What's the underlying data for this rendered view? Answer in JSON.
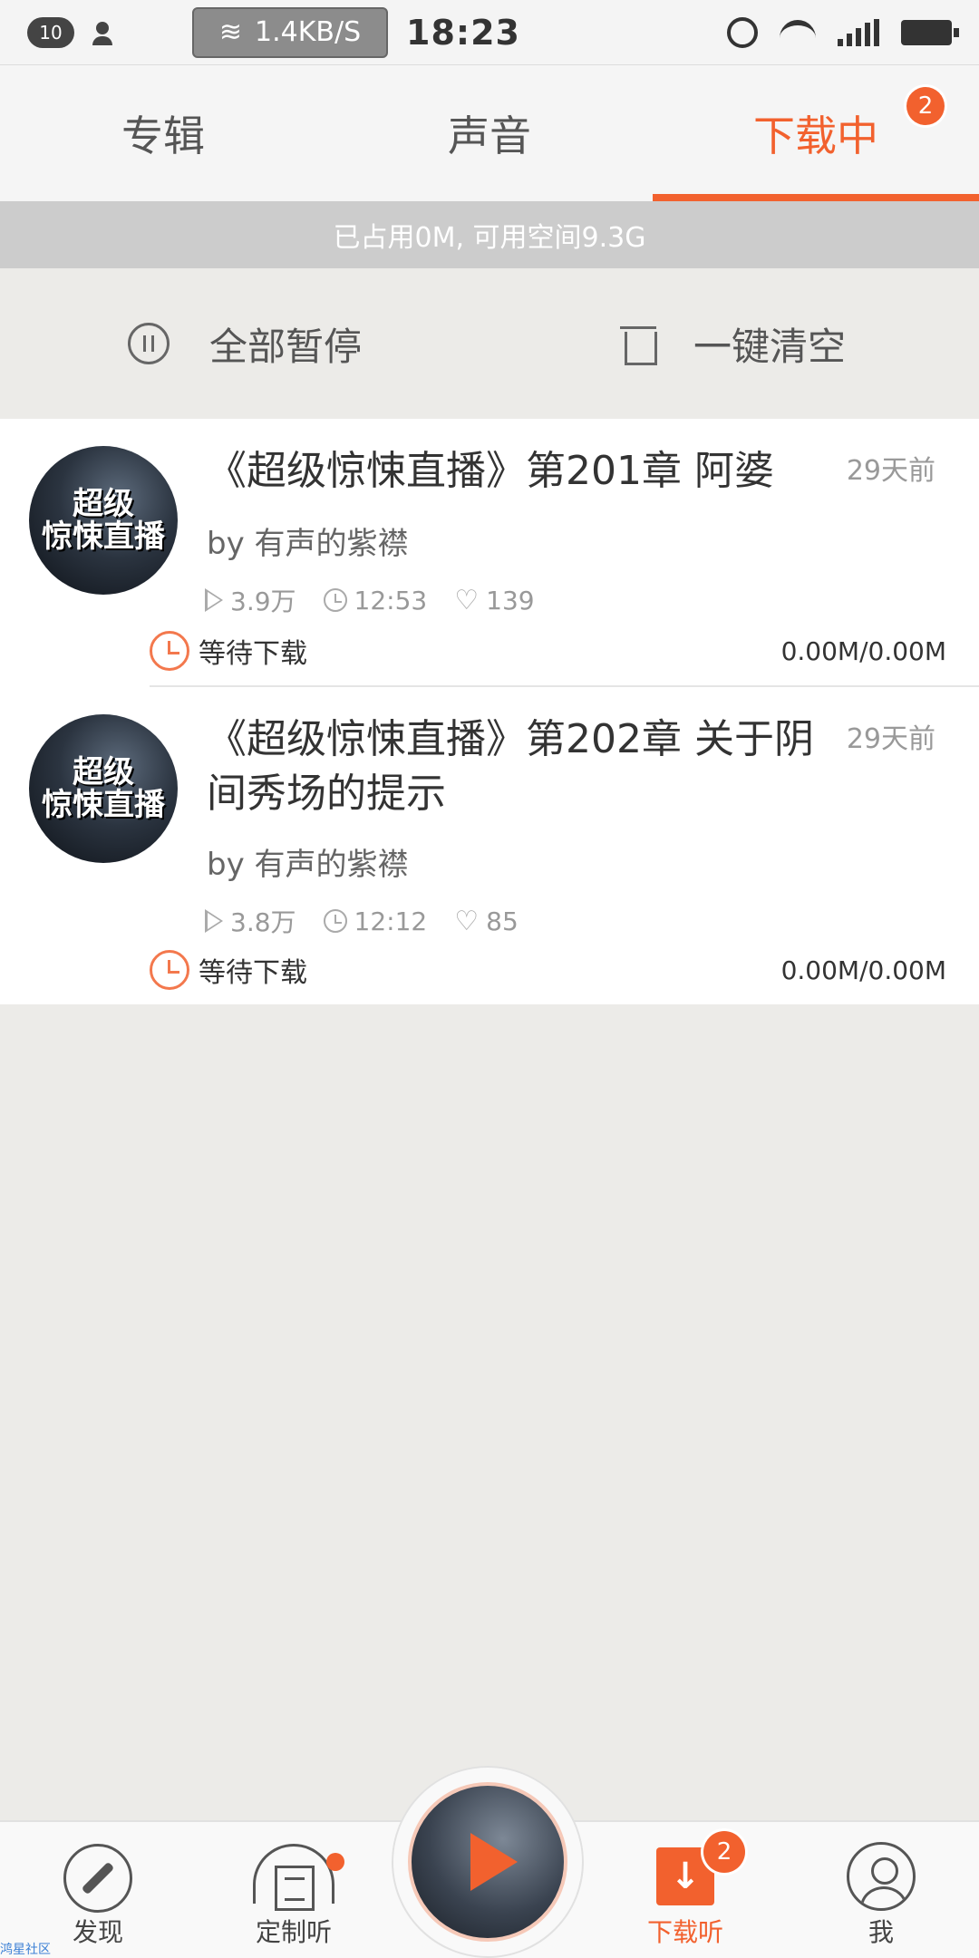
{
  "status_bar": {
    "notification_count": "10",
    "net_speed": "1.4KB/S",
    "time": "18:23"
  },
  "tabs": [
    {
      "label": "专辑"
    },
    {
      "label": "声音"
    },
    {
      "label": "下载中",
      "badge": "2"
    }
  ],
  "storage_info": "已占用0M, 可用空间9.3G",
  "actions": {
    "pause_all": "全部暂停",
    "clear_all": "一键清空"
  },
  "downloads": [
    {
      "cover_text": "超级\n惊悚直播",
      "title": "《超级惊悚直播》第201章 阿婆",
      "time_ago": "29天前",
      "author": "by 有声的紫襟",
      "plays": "3.9万",
      "duration": "12:53",
      "likes": "139",
      "status": "等待下载",
      "size": "0.00M/0.00M"
    },
    {
      "cover_text": "超级\n惊悚直播",
      "title": "《超级惊悚直播》第202章 关于阴间秀场的提示",
      "time_ago": "29天前",
      "author": "by 有声的紫襟",
      "plays": "3.8万",
      "duration": "12:12",
      "likes": "85",
      "status": "等待下载",
      "size": "0.00M/0.00M"
    }
  ],
  "bottom_nav": {
    "discover": "发现",
    "custom": "定制听",
    "download": "下载听",
    "download_badge": "2",
    "me": "我"
  },
  "watermark": "鸿星社区",
  "colors": {
    "accent": "#f2612e",
    "background": "#ecebe8"
  }
}
